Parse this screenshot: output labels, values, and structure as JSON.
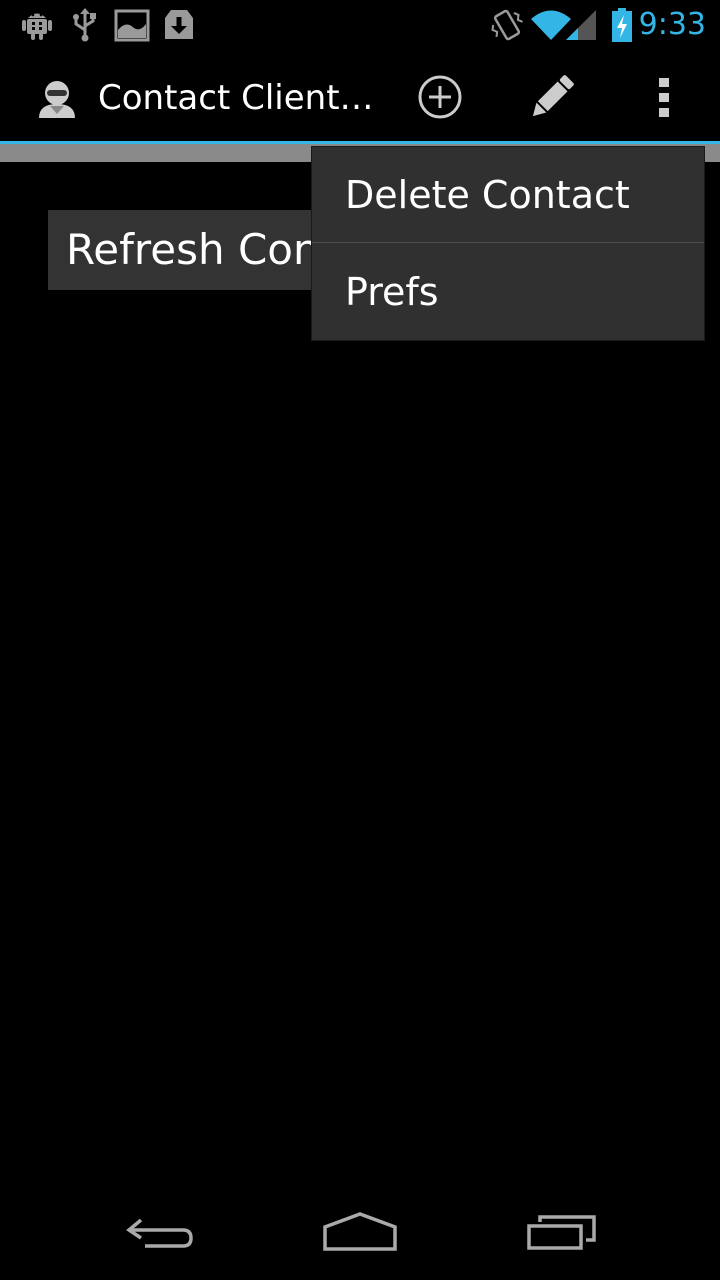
{
  "status_bar": {
    "time": "9:33",
    "icons": [
      "android-debug-icon",
      "usb-icon",
      "image-icon",
      "download-icon",
      "vibrate-icon",
      "wifi-icon",
      "signal-icon",
      "battery-charging-icon"
    ],
    "accent": "#33b5e5"
  },
  "action_bar": {
    "title": "Contact Client…",
    "icons": [
      "app-contact-icon",
      "add-icon",
      "pencil-icon",
      "overflow-menu-icon"
    ]
  },
  "main": {
    "refresh_button_label": "Refresh Con"
  },
  "overflow_menu": {
    "items": [
      {
        "label": "Delete Contact"
      },
      {
        "label": "Prefs"
      }
    ]
  },
  "nav_bar": {
    "icons": [
      "back-icon",
      "home-icon",
      "recents-icon"
    ]
  }
}
